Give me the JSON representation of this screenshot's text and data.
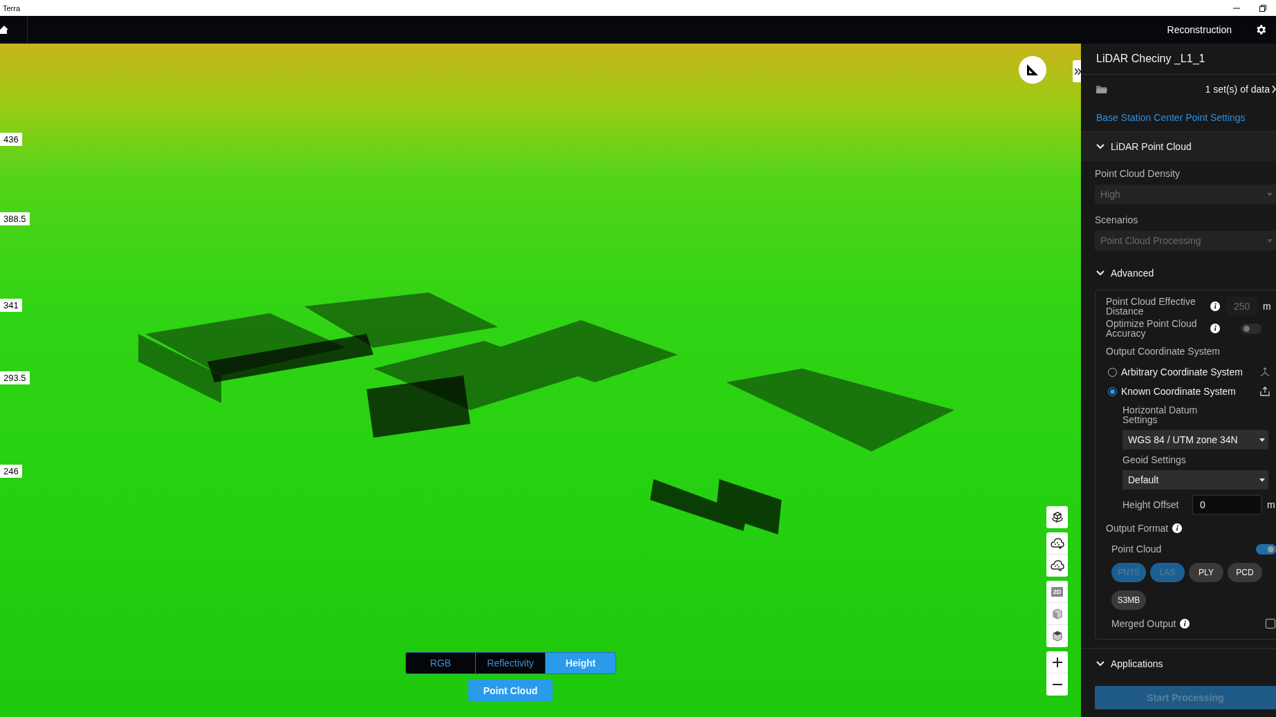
{
  "window": {
    "title": "Terra"
  },
  "app_bar": {
    "title": "Reconstruction"
  },
  "viewer": {
    "height_scale": [
      "436",
      "388.5",
      "341",
      "293.5",
      "246"
    ],
    "toolbar": {
      "label_2d": "2D"
    },
    "color_modes": [
      {
        "label": "RGB",
        "selected": false
      },
      {
        "label": "Reflectivity",
        "selected": false
      },
      {
        "label": "Height",
        "selected": true
      }
    ],
    "layer_button": {
      "label": "Point Cloud",
      "selected": true
    }
  },
  "panel": {
    "title": "LiDAR Checiny _L1_1",
    "data_count": "1 set(s) of data",
    "link": "Base Station Center Point Settings",
    "lidar_section": {
      "title": "LiDAR Point Cloud",
      "density": {
        "label": "Point Cloud Density",
        "value": "High",
        "disabled": true
      },
      "scenarios": {
        "label": "Scenarios",
        "value": "Point Cloud Processing",
        "disabled": true
      }
    },
    "advanced": {
      "title": "Advanced",
      "effective_distance": {
        "label": "Point Cloud Effective Distance",
        "value": "250",
        "unit": "m",
        "disabled": true
      },
      "optimize_accuracy": {
        "label": "Optimize Point Cloud Accuracy",
        "on": false
      },
      "coordinate_system": {
        "label": "Output Coordinate System",
        "options": [
          {
            "label": "Arbitrary Coordinate System",
            "selected": false
          },
          {
            "label": "Known Coordinate System",
            "selected": true
          }
        ],
        "horizontal_datum": {
          "label": "Horizontal Datum Settings",
          "value": "WGS 84 / UTM zone 34N"
        },
        "geoid": {
          "label": "Geoid Settings",
          "value": "Default"
        },
        "height_offset": {
          "label": "Height Offset",
          "value": "0",
          "unit": "m"
        }
      },
      "output_format": {
        "label": "Output Format",
        "point_cloud": {
          "label": "Point Cloud",
          "on": true
        },
        "formats": [
          {
            "label": "PNTS",
            "selected": true
          },
          {
            "label": "LAS",
            "selected": true
          },
          {
            "label": "PLY",
            "selected": false
          },
          {
            "label": "PCD",
            "selected": false
          },
          {
            "label": "S3MB",
            "selected": false
          }
        ],
        "merged_output": {
          "label": "Merged Output",
          "checked": false
        }
      }
    },
    "applications": {
      "title": "Applications"
    },
    "start_button": {
      "label": "Start Processing",
      "disabled": true
    }
  }
}
